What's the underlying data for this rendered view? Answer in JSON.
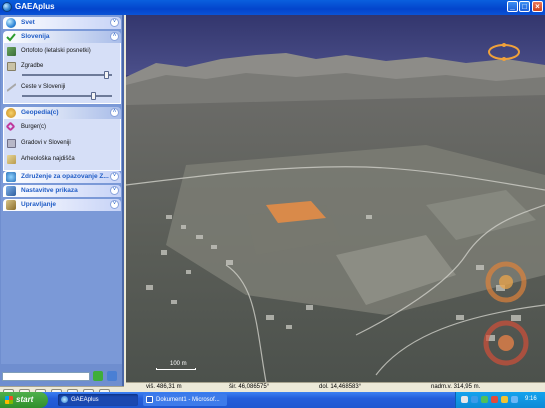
{
  "window": {
    "title": "GAEAplus",
    "buttons": {
      "minimize": "_",
      "maximize": "□",
      "close": "×"
    }
  },
  "sidebar": {
    "groups": [
      {
        "label": "Svet",
        "icon": "globe-icon",
        "expanded": false
      },
      {
        "label": "Slovenija",
        "icon": "check-icon",
        "expanded": true,
        "items": [
          {
            "label": "Ortofoto (letalski posnetki)",
            "icon": "photo-icon"
          },
          {
            "label": "Zgradbe",
            "icon": "building-icon"
          },
          {
            "label": "Ceste v Sloveniji",
            "icon": "road-icon"
          }
        ],
        "slider1_value": 0.95,
        "slider2_value": 0.8
      },
      {
        "label": "Geopedia(c)",
        "icon": "geopedia-icon",
        "expanded": true,
        "items": [
          {
            "label": "Burger(c)",
            "icon": "burger-icon"
          },
          {
            "label": "Gradovi v Sloveniji",
            "icon": "castle-icon"
          },
          {
            "label": "Arheološka najdišča",
            "icon": "archaeology-icon"
          }
        ]
      },
      {
        "label": "Združenje za opazovanje Z...",
        "icon": "observation-icon",
        "expanded": false
      },
      {
        "label": "Nastavitve prikaza",
        "icon": "display-settings-icon",
        "expanded": false
      },
      {
        "label": "Upravljanje",
        "icon": "management-icon",
        "expanded": false
      }
    ],
    "search": {
      "value": "",
      "placeholder": ""
    }
  },
  "view3d": {
    "scale_label": "100 m"
  },
  "status": {
    "visina": "viš.   486,31 m",
    "sirina": "šir. 46,086575°",
    "dolzina": "dol. 14,468583°",
    "nadmorska": "nadm.v.   314,95 m."
  },
  "taskbar": {
    "start_label": "start",
    "tasks": [
      {
        "label": "GAEAplus",
        "active": true
      },
      {
        "label": "Dokument1 - Microsof...",
        "active": false
      }
    ],
    "clock": "9:16"
  },
  "colors": {
    "title_bar": "#0a53d6",
    "sidebar_bg": "#7b99d7",
    "sky": "#3a3e78",
    "sports_field": "#d98a4a",
    "place_label": "#e06a54"
  }
}
